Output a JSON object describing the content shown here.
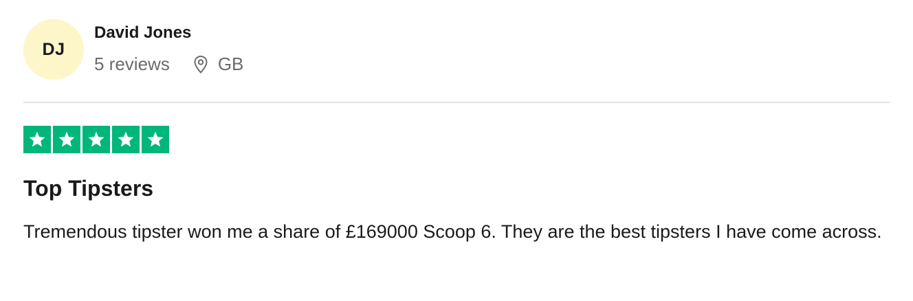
{
  "reviewer": {
    "initials": "DJ",
    "name": "David Jones",
    "review_count": "5 reviews",
    "country": "GB",
    "avatar_color": "#fdf6c9"
  },
  "review": {
    "rating": 5,
    "max_rating": 5,
    "star_color": "#00b67a",
    "title": "Top Tipsters",
    "body": "Tremendous tipster won me a share of £169000 Scoop 6. They are the best tipsters I have come across."
  },
  "icons": {
    "location": "location-pin-icon",
    "star": "star-icon"
  }
}
